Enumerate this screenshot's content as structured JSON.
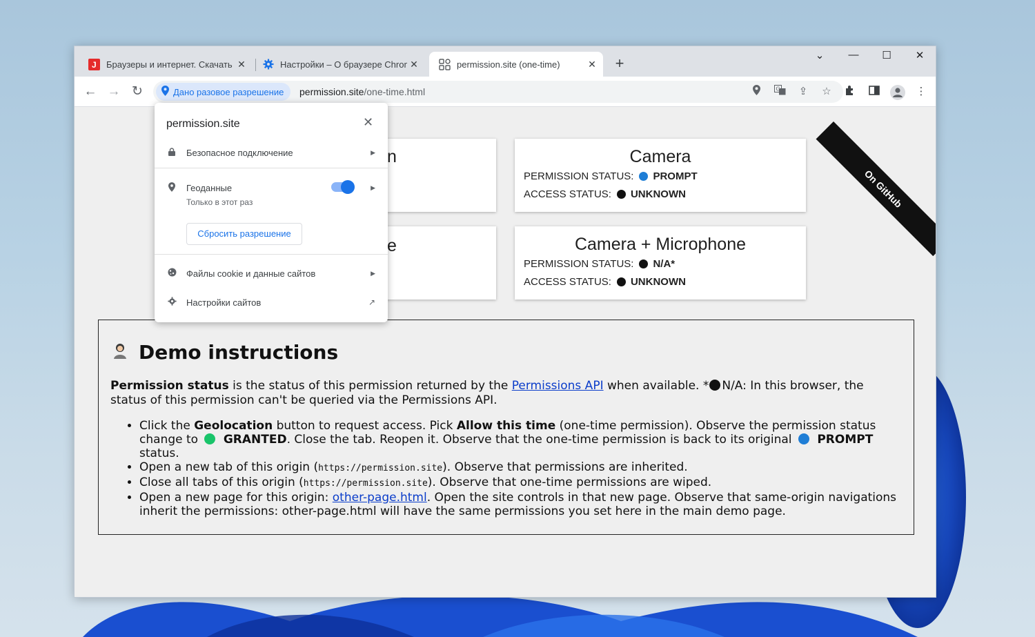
{
  "tabs": [
    {
      "title": "Браузеры и интернет. Скачать б",
      "icon": "red-logo-icon"
    },
    {
      "title": "Настройки – О браузере Chrom",
      "icon": "gear-icon"
    },
    {
      "title": "permission.site (one-time)",
      "icon": "permission-site-icon"
    }
  ],
  "chip": {
    "label": "Дано разовое разрешение"
  },
  "address": {
    "host": "permission.site",
    "path": "/one-time.html"
  },
  "popup": {
    "site": "permission.site",
    "secure": "Безопасное подключение",
    "geo": "Геоданные",
    "geo_sub": "Только в этот раз",
    "reset": "Сбросить разрешение",
    "cookies": "Файлы cookie и данные сайтов",
    "site_settings": "Настройки сайтов"
  },
  "cards": [
    {
      "title": "Camera",
      "perm_label": "PERMISSION STATUS:",
      "perm_value": "PROMPT",
      "perm_color": "#1f7ed6",
      "access_label": "ACCESS STATUS:",
      "access_value": "UNKNOWN",
      "access_color": "#111111"
    },
    {
      "title": "Camera + Microphone",
      "perm_label": "PERMISSION STATUS:",
      "perm_value": "N/A*",
      "perm_color": "#111111",
      "access_label": "ACCESS STATUS:",
      "access_value": "UNKNOWN",
      "access_color": "#111111"
    }
  ],
  "hidden_cards": [
    {
      "letter": "n"
    },
    {
      "letter": "e"
    }
  ],
  "ribbon": "On GitHub",
  "demo": {
    "title": "Demo instructions",
    "p_bold": "Permission status",
    "p_text1": " is the status of this permission returned by the ",
    "p_link": "Permissions API",
    "p_text2": " when available. *",
    "p_text3": "N/A: In this browser, the status of this permission can't be queried via the Permissions API.",
    "b1_a": "Click the ",
    "b1_geo": "Geolocation",
    "b1_b": " button to request access. Pick ",
    "b1_allow": "Allow this time",
    "b1_c": " (one-time permission). Observe the permission status change to ",
    "b1_granted": "GRANTED",
    "b1_d": ". Close the tab. Reopen it. Observe that the one-time permission is back to its original ",
    "b1_prompt": "PROMPT",
    "b1_e": " status.",
    "b2_a": "Open a new tab of this origin (",
    "b2_code": "https://permission.site",
    "b2_b": "). Observe that permissions are inherited.",
    "b3_a": "Close all tabs of this origin (",
    "b3_code": "https://permission.site",
    "b3_b": "). Observe that one-time permissions are wiped.",
    "b4_a": "Open a new page for this origin: ",
    "b4_link": "other-page.html",
    "b4_b": ". Open the site controls in that new page. Observe that same-origin navigations inherit the permissions: other-page.html will have the same permissions you set here in the main demo page."
  },
  "colors": {
    "granted": "#19c46a",
    "prompt": "#1f7ed6",
    "accent": "#1a73e8"
  }
}
